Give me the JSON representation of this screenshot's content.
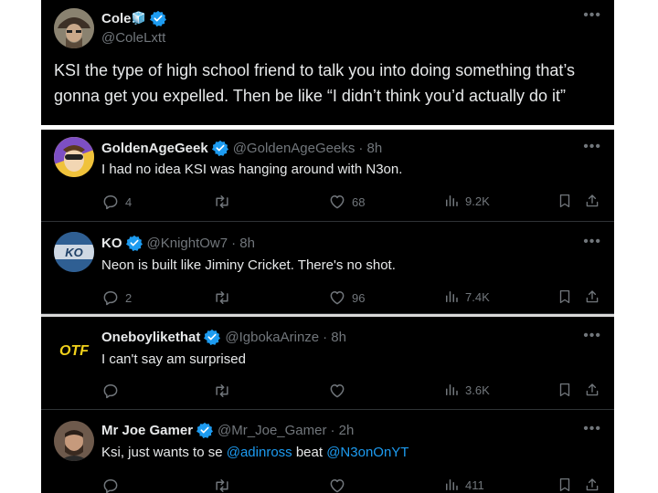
{
  "main_tweet": {
    "name": "Cole",
    "name_emoji": "🧊",
    "handle": "@ColeLxtt",
    "text_line1": "KSI the type of high school friend to talk you into doing something that’s",
    "text_line2": "gonna get you expelled. Then be like “I didn’t think you’d actually do it”"
  },
  "replies": [
    {
      "name": "GoldenAgeGeek",
      "handle": "@GoldenAgeGeeks",
      "time": "· 8h",
      "text": "I had no idea KSI was hanging around with N3on.",
      "replies": "4",
      "retweets": "",
      "likes": "68",
      "views": "9.2K"
    },
    {
      "name": "KO",
      "handle": "@KnightOw7",
      "time": "· 8h",
      "text": "Neon is built like Jiminy Cricket. There's no shot.",
      "replies": "2",
      "retweets": "",
      "likes": "96",
      "views": "7.4K"
    },
    {
      "name": "Oneboylikethat",
      "handle": "@IgbokaArinze",
      "time": "· 8h",
      "text": "I can't say am surprised",
      "replies": "",
      "retweets": "",
      "likes": "",
      "views": "3.6K"
    },
    {
      "name": "Mr Joe Gamer",
      "handle": "@Mr_Joe_Gamer",
      "time": "· 2h",
      "text_prefix": "Ksi, just wants to se ",
      "mention1": "@adinross",
      "text_mid": " beat ",
      "mention2": "@N3onOnYT",
      "replies": "",
      "retweets": "",
      "likes": "",
      "views": "411"
    }
  ],
  "icons": {
    "more": "more-icon",
    "verified": "verified-badge-icon",
    "reply": "reply-icon",
    "retweet": "retweet-icon",
    "like": "like-icon",
    "views": "views-icon",
    "bookmark": "bookmark-icon",
    "share": "share-icon"
  },
  "colors": {
    "background": "#000000",
    "text": "#e7e9ea",
    "secondary": "#71767b",
    "accent": "#1d9bf0"
  }
}
